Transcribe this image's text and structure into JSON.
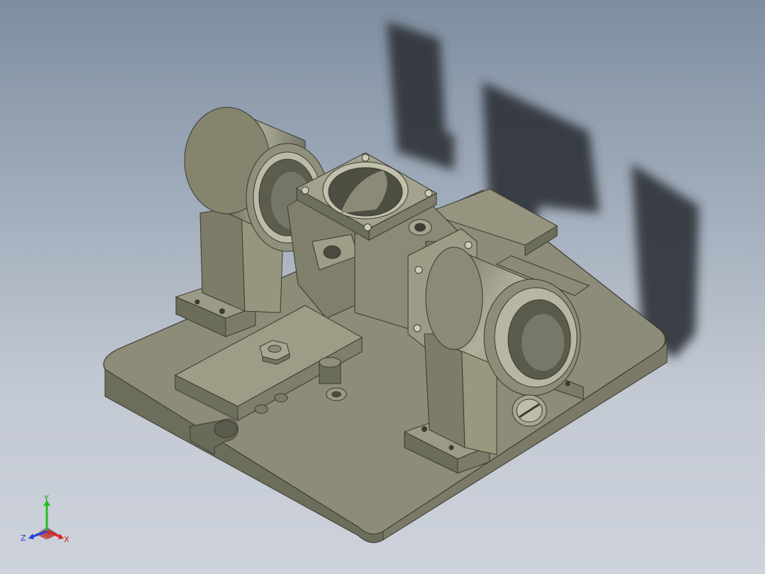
{
  "viewport": {
    "background_top": "#7e8ea0",
    "background_bottom": "#cdd2db",
    "model_color": "#8e8e7a",
    "model_shadow_color": "#2f3338"
  },
  "triad": {
    "x_label": "X",
    "y_label": "Y",
    "z_label": "Z",
    "x_color": "#e02020",
    "y_color": "#20c020",
    "z_color": "#2040e0"
  }
}
